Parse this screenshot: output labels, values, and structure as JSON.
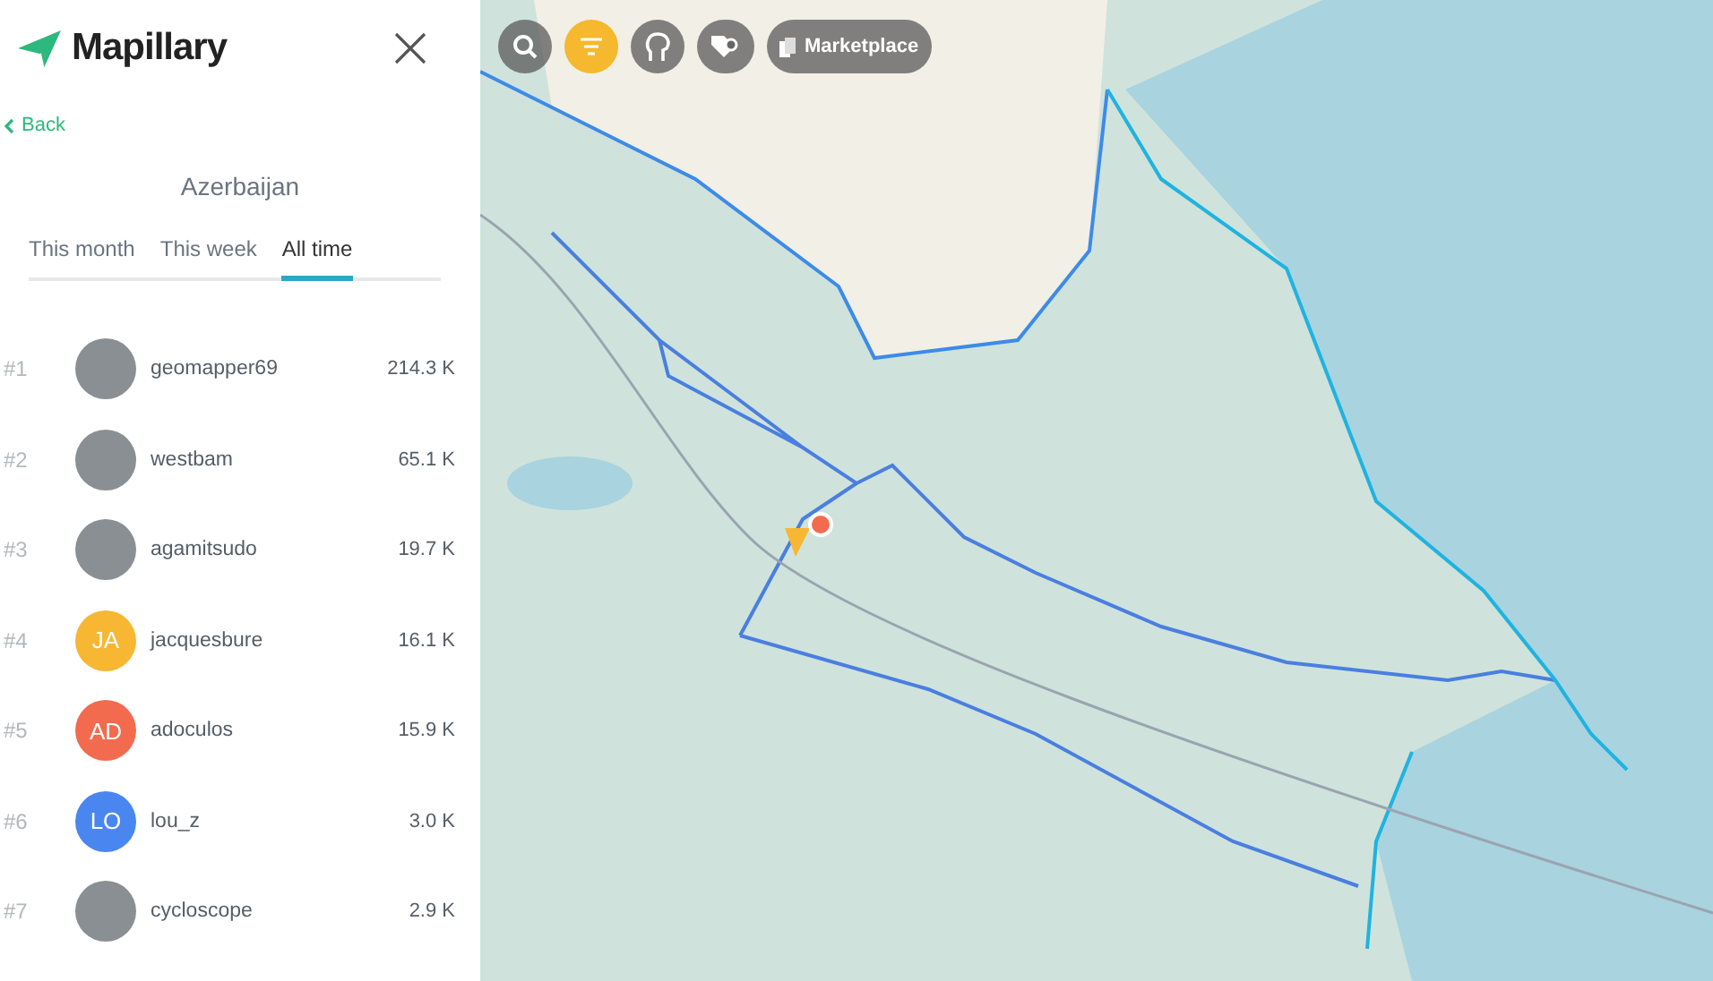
{
  "brand": {
    "name": "Mapillary"
  },
  "back": {
    "label": "Back"
  },
  "region": {
    "title": "Azerbaijan"
  },
  "tabs": [
    {
      "label": "This month",
      "selected": false
    },
    {
      "label": "This week",
      "selected": false
    },
    {
      "label": "All time",
      "selected": true
    }
  ],
  "leaderboard": [
    {
      "rank": "#1",
      "kind": "photo",
      "name": "geomapper69",
      "count": "214.3 K"
    },
    {
      "rank": "#2",
      "kind": "photo",
      "name": "westbam",
      "count": "65.1 K"
    },
    {
      "rank": "#3",
      "kind": "photo",
      "name": "agamitsudo",
      "count": "19.7 K"
    },
    {
      "rank": "#4",
      "kind": "initials",
      "initials": "JA",
      "color": "#f7b733",
      "name": "jacquesbure",
      "count": "16.1 K"
    },
    {
      "rank": "#5",
      "kind": "initials",
      "initials": "AD",
      "color": "#f26b4f",
      "name": "adoculos",
      "count": "15.9 K"
    },
    {
      "rank": "#6",
      "kind": "initials",
      "initials": "LO",
      "color": "#4a86f0",
      "name": "lou_z",
      "count": "3.0 K"
    },
    {
      "rank": "#7",
      "kind": "photo",
      "name": "cycloscope",
      "count": "2.9 K"
    }
  ],
  "toolbar": [
    {
      "kind": "search",
      "selected": false
    },
    {
      "kind": "filter",
      "selected": true
    },
    {
      "kind": "person",
      "selected": false
    },
    {
      "kind": "tag",
      "selected": false
    },
    {
      "kind": "marketplace",
      "label": "Marketplace",
      "selected": false
    }
  ]
}
